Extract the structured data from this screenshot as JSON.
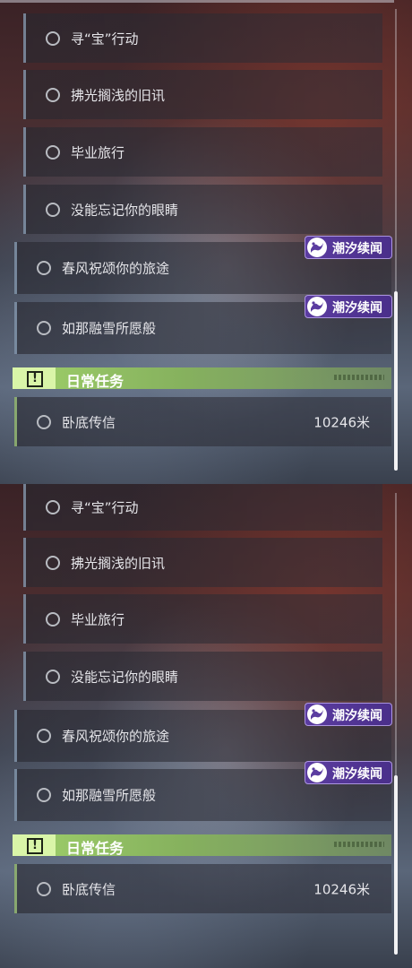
{
  "quests": {
    "sub": [
      {
        "label": "寻“宝”行动"
      },
      {
        "label": "拂光搁浅的旧讯"
      },
      {
        "label": "毕业旅行"
      },
      {
        "label": "没能忘记你的眼睛"
      }
    ],
    "main": [
      {
        "label": "春风祝颂你的旅途",
        "badge": "潮汐续闻"
      },
      {
        "label": "如那融雪所愿般",
        "badge": "潮汐续闻"
      }
    ],
    "daily_header": "日常任务",
    "daily": [
      {
        "label": "卧底传信",
        "distance": "10246米"
      }
    ]
  },
  "colors": {
    "badge": "#5b3ca0",
    "daily_accent": "#9fd06a"
  },
  "icons": {
    "quest_status": "ring-icon",
    "badge": "wave-logo-icon",
    "daily": "exclamation-icon"
  }
}
